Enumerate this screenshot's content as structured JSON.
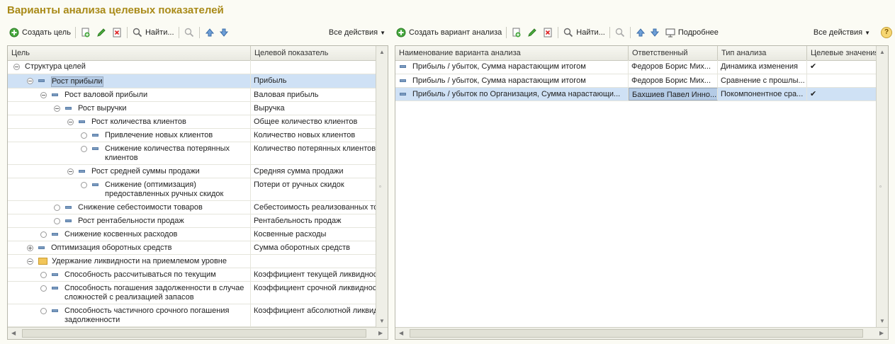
{
  "title": "Варианты анализа целевых показателей",
  "left_toolbar": {
    "create_label": "Создать цель",
    "find_label": "Найти...",
    "all_actions": "Все действия"
  },
  "right_toolbar": {
    "create_label": "Создать вариант анализа",
    "find_label": "Найти...",
    "details_label": "Подробнее",
    "all_actions": "Все действия"
  },
  "goals_table": {
    "columns": [
      "Цель",
      "Целевой показатель"
    ],
    "rows": [
      {
        "goal": "Структура целей",
        "indicator": ""
      },
      {
        "goal": "Рост прибыли",
        "indicator": "Прибыль"
      },
      {
        "goal": "Рост валовой прибыли",
        "indicator": "Валовая прибыль"
      },
      {
        "goal": "Рост выручки",
        "indicator": "Выручка"
      },
      {
        "goal": "Рост количества клиентов",
        "indicator": "Общее количество клиентов"
      },
      {
        "goal": "Привлечение новых клиентов",
        "indicator": "Количество новых клиентов"
      },
      {
        "goal": "Снижение количества потерянных клиентов",
        "indicator": "Количество потерянных клиентов"
      },
      {
        "goal": "Рост средней суммы продажи",
        "indicator": "Средняя сумма продажи"
      },
      {
        "goal": "Снижение (оптимизация) предоставленных ручных скидок",
        "indicator": "Потери от ручных скидок"
      },
      {
        "goal": "Снижение себестоимости товаров",
        "indicator": "Себестоимость реализованных то"
      },
      {
        "goal": "Рост рентабельности продаж",
        "indicator": "Рентабельность продаж"
      },
      {
        "goal": "Снижение косвенных расходов",
        "indicator": "Косвенные расходы"
      },
      {
        "goal": "Оптимизация оборотных средств",
        "indicator": "Сумма оборотных средств"
      },
      {
        "goal": "Удержание ликвидности на приемлемом уровне",
        "indicator": ""
      },
      {
        "goal": "Способность рассчитываться по текущим",
        "indicator": "Коэффициент текущей ликвидност"
      },
      {
        "goal": "Способность погашения задолженности в случае сложностей с реализацией запасов",
        "indicator": "Коэффициент срочной ликвидност"
      },
      {
        "goal": "Способность частичного срочного погашения задолженности",
        "indicator": "Коэффициент абсолютной ликвид"
      }
    ]
  },
  "variants_table": {
    "columns": [
      "Наименование варианта анализа",
      "Ответственный",
      "Тип анализа",
      "Целевые значения"
    ],
    "rows": [
      {
        "name": "Прибыль / убыток, Сумма нарастающим итогом",
        "responsible": "Федоров Борис Мих...",
        "type": "Динамика изменения",
        "target": "✔"
      },
      {
        "name": "Прибыль / убыток, Сумма нарастающим итогом",
        "responsible": "Федоров Борис Мих...",
        "type": "Сравнение с прошлы...",
        "target": ""
      },
      {
        "name": "Прибыль / убыток по Организация, Сумма нарастающи...",
        "responsible": "Бахшиев Павел Инно...",
        "type": "Покомпонентное сра...",
        "target": "✔"
      }
    ]
  },
  "colors": {
    "title": "#a98a18",
    "selection": "#cfe1f5",
    "accent_green": "#3fa33a"
  }
}
